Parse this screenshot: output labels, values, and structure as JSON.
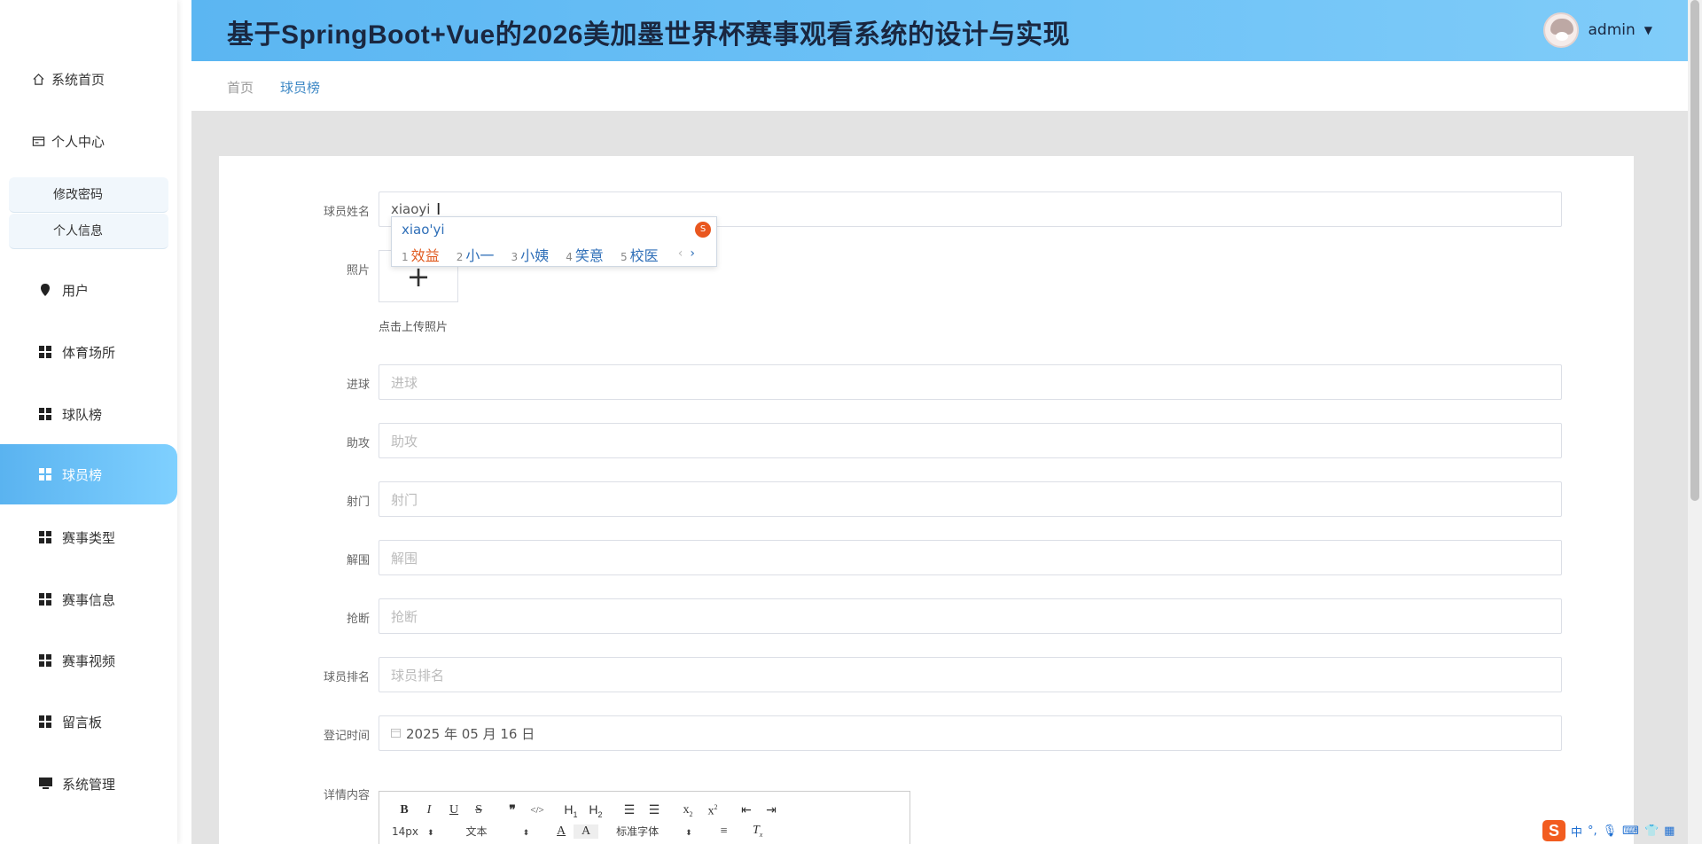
{
  "app": {
    "title": "基于SpringBoot+Vue的2026美加墨世界杯赛事观看系统的设计与实现",
    "user": "admin"
  },
  "sidebar": {
    "items": [
      {
        "label": "系统首页",
        "icon": "home-icon"
      },
      {
        "label": "个人中心",
        "icon": "profile-card-icon"
      },
      {
        "label": "用户",
        "icon": "pin-icon"
      },
      {
        "label": "体育场所",
        "icon": "grid-icon"
      },
      {
        "label": "球队榜",
        "icon": "grid-icon"
      },
      {
        "label": "球员榜",
        "icon": "grid-icon",
        "active": true
      },
      {
        "label": "赛事类型",
        "icon": "grid-icon"
      },
      {
        "label": "赛事信息",
        "icon": "grid-icon"
      },
      {
        "label": "赛事视频",
        "icon": "grid-icon"
      },
      {
        "label": "留言板",
        "icon": "grid-icon"
      },
      {
        "label": "系统管理",
        "icon": "monitor-icon"
      }
    ],
    "sub_items": [
      "修改密码",
      "个人信息"
    ]
  },
  "breadcrumb": {
    "home": "首页",
    "current": "球员榜"
  },
  "form": {
    "name_label": "球员姓名",
    "name_value": "xiaoyi",
    "photo_label": "照片",
    "upload_note": "点击上传照片",
    "goals_label": "进球",
    "goals_placeholder": "进球",
    "assists_label": "助攻",
    "assists_placeholder": "助攻",
    "shots_label": "射门",
    "shots_placeholder": "射门",
    "clear_label": "解围",
    "clear_placeholder": "解围",
    "tackle_label": "抢断",
    "tackle_placeholder": "抢断",
    "rank_label": "球员排名",
    "rank_placeholder": "球员排名",
    "date_label": "登记时间",
    "date_value": "2025 年 05 月 16 日",
    "detail_label": "详情内容"
  },
  "ime": {
    "pinyin": "xiao'yi",
    "candidates": [
      {
        "n": "1",
        "text": "效益"
      },
      {
        "n": "2",
        "text": "小一"
      },
      {
        "n": "3",
        "text": "小姨"
      },
      {
        "n": "4",
        "text": "笑意"
      },
      {
        "n": "5",
        "text": "校医"
      }
    ]
  },
  "editor": {
    "font_size": "14px",
    "block_type": "文本",
    "font_family": "标准字体"
  },
  "tray": {
    "lang": "中"
  },
  "colors": {
    "accent": "#3d88c5",
    "header_start": "#5bb6f2",
    "active_start": "#5ab3f0",
    "ime_red": "#e05a1f"
  }
}
